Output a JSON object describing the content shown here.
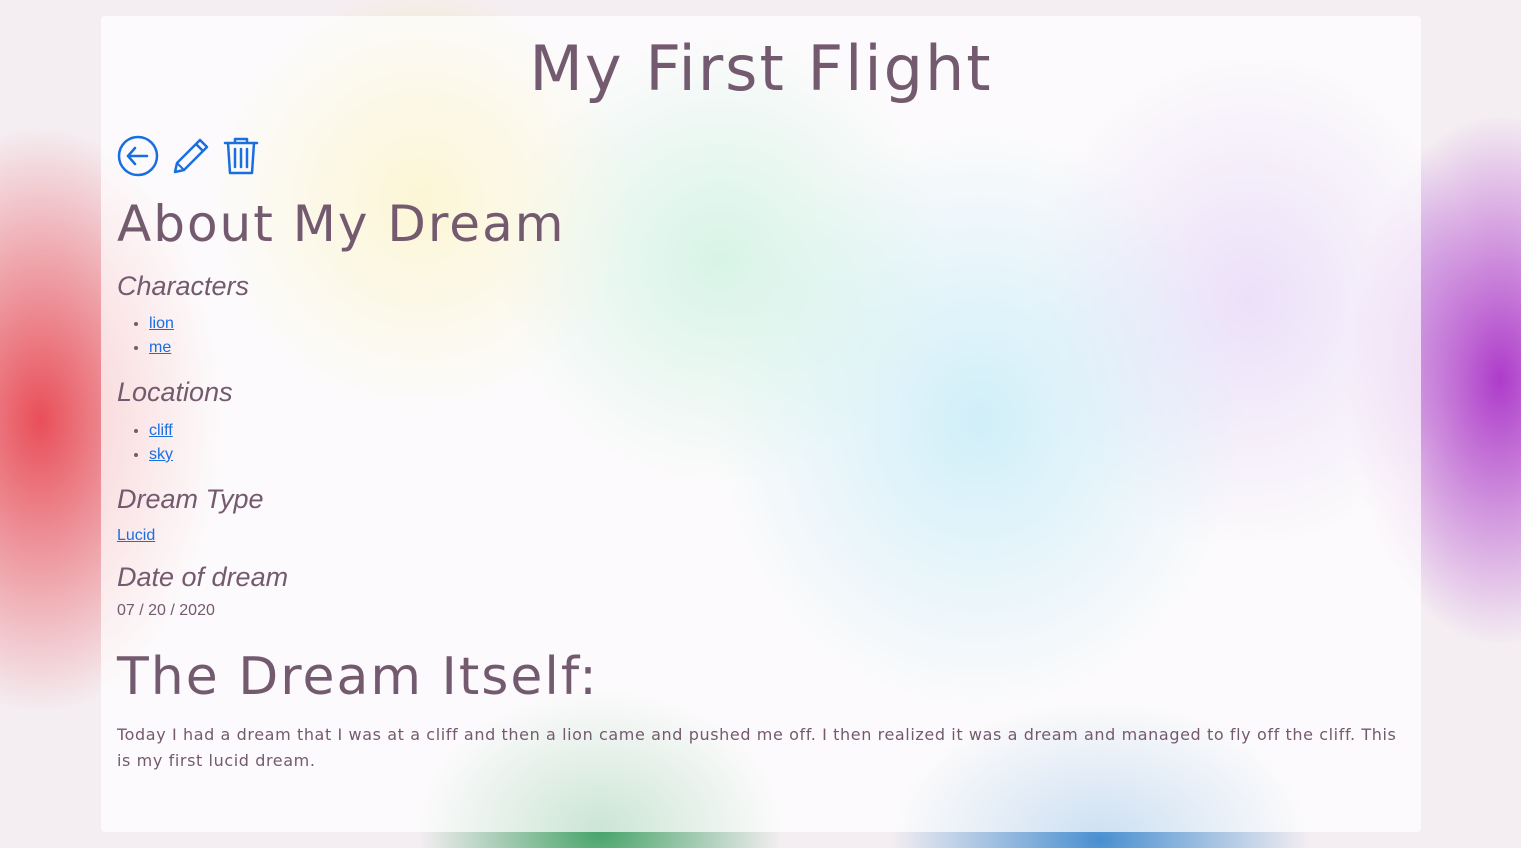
{
  "page": {
    "title": "My First Flight"
  },
  "actions": {
    "back_icon": "arrow-left-circle-icon",
    "edit_icon": "pencil-icon",
    "delete_icon": "trash-icon",
    "accent_color": "#1a6fe0"
  },
  "about": {
    "heading": "About My Dream",
    "characters_label": "Characters",
    "characters": [
      "lion",
      "me"
    ],
    "locations_label": "Locations",
    "locations": [
      "cliff",
      "sky"
    ],
    "dream_type_label": "Dream Type",
    "dream_type": "Lucid",
    "date_label": "Date of dream",
    "date": "07 / 20 / 2020"
  },
  "dream": {
    "heading": "The Dream Itself:",
    "text": "Today I had a dream that I was at a cliff and then a lion came and pushed me off. I then realized it was a dream and managed to fly off the cliff. This is my first lucid dream."
  },
  "colors": {
    "text": "#745a6f",
    "link": "#1a6fe0"
  }
}
